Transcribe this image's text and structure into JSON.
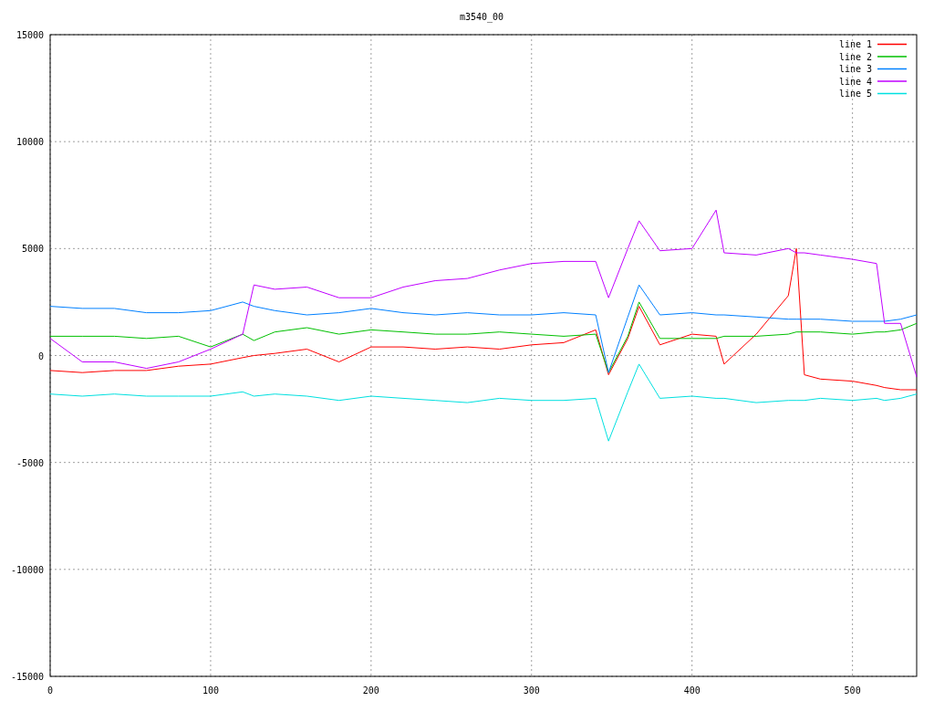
{
  "chart_data": {
    "type": "line",
    "title": "m3540_00",
    "xlim": [
      0,
      540
    ],
    "ylim": [
      -15000,
      15000
    ],
    "xticks": [
      0,
      100,
      200,
      300,
      400,
      500
    ],
    "yticks": [
      -15000,
      -10000,
      -5000,
      0,
      5000,
      10000,
      15000
    ],
    "grid": true,
    "legend": true,
    "x": [
      0,
      20,
      40,
      60,
      80,
      100,
      120,
      127,
      140,
      160,
      180,
      200,
      220,
      240,
      260,
      280,
      300,
      320,
      340,
      348,
      360,
      367,
      380,
      400,
      415,
      420,
      440,
      460,
      465,
      470,
      480,
      500,
      515,
      520,
      530,
      540
    ],
    "series": [
      {
        "name": "line 1",
        "color": "#ff0000",
        "values": [
          -700,
          -800,
          -700,
          -700,
          -500,
          -400,
          -100,
          0,
          100,
          300,
          -300,
          400,
          400,
          300,
          400,
          300,
          500,
          600,
          1200,
          -900,
          800,
          2300,
          500,
          1000,
          900,
          -400,
          1000,
          2800,
          5000,
          -900,
          -1100,
          -1200,
          -1400,
          -1500,
          -1600,
          -1600
        ]
      },
      {
        "name": "line 2",
        "color": "#00c000",
        "values": [
          900,
          900,
          900,
          800,
          900,
          400,
          1000,
          700,
          1100,
          1300,
          1000,
          1200,
          1100,
          1000,
          1000,
          1100,
          1000,
          900,
          1000,
          -800,
          900,
          2500,
          800,
          800,
          800,
          900,
          900,
          1000,
          1100,
          1100,
          1100,
          1000,
          1100,
          1100,
          1200,
          1500
        ]
      },
      {
        "name": "line 3",
        "color": "#0080ff",
        "values": [
          2300,
          2200,
          2200,
          2000,
          2000,
          2100,
          2500,
          2300,
          2100,
          1900,
          2000,
          2200,
          2000,
          1900,
          2000,
          1900,
          1900,
          2000,
          1900,
          -800,
          1800,
          3300,
          1900,
          2000,
          1900,
          1900,
          1800,
          1700,
          1700,
          1700,
          1700,
          1600,
          1600,
          1600,
          1700,
          1900
        ]
      },
      {
        "name": "line 4",
        "color": "#c000ff",
        "values": [
          800,
          -300,
          -300,
          -600,
          -300,
          300,
          1000,
          3300,
          3100,
          3200,
          2700,
          2700,
          3200,
          3500,
          3600,
          4000,
          4300,
          4400,
          4400,
          2700,
          5000,
          6300,
          4900,
          5000,
          6800,
          4800,
          4700,
          5000,
          4800,
          4800,
          4700,
          4500,
          4300,
          1500,
          1500,
          -1000
        ]
      },
      {
        "name": "line 5",
        "color": "#00e0e0",
        "values": [
          -1800,
          -1900,
          -1800,
          -1900,
          -1900,
          -1900,
          -1700,
          -1900,
          -1800,
          -1900,
          -2100,
          -1900,
          -2000,
          -2100,
          -2200,
          -2000,
          -2100,
          -2100,
          -2000,
          -4000,
          -1700,
          -400,
          -2000,
          -1900,
          -2000,
          -2000,
          -2200,
          -2100,
          -2100,
          -2100,
          -2000,
          -2100,
          -2000,
          -2100,
          -2000,
          -1800
        ]
      }
    ]
  }
}
